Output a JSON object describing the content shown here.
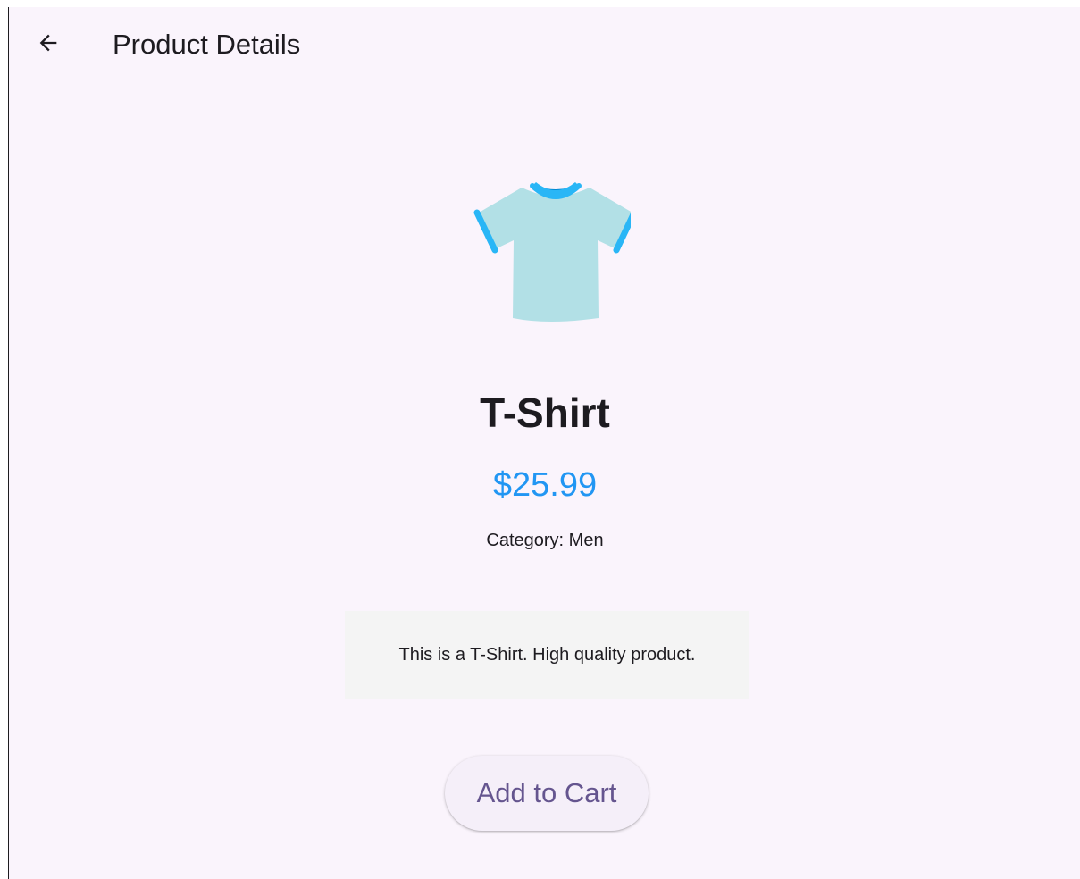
{
  "app_bar": {
    "back_icon": "arrow-back-icon",
    "title": "Product Details"
  },
  "product": {
    "image_icon": "t-shirt-icon",
    "name": "T-Shirt",
    "price": "$25.99",
    "category": "Category: Men",
    "description": "This is a T-Shirt. High quality product."
  },
  "actions": {
    "add_to_cart_label": "Add to Cart"
  },
  "colors": {
    "background": "#faf4fc",
    "price": "#2196f3",
    "button_text": "#65558f",
    "button_background": "#f5eff9",
    "description_background": "#f4f4f4",
    "shirt_body": "#b2e0e6",
    "shirt_trim": "#29b6f6"
  }
}
